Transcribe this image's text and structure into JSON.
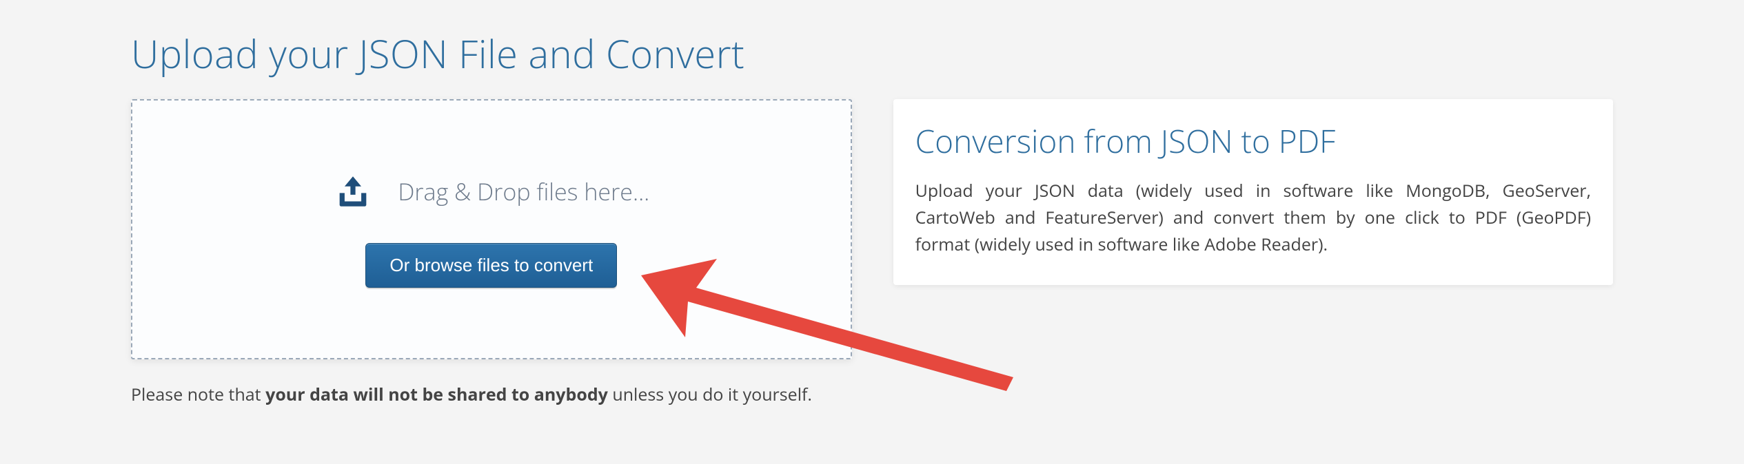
{
  "header": {
    "title": "Upload your JSON File and Convert"
  },
  "dropzone": {
    "drag_label": "Drag & Drop files here...",
    "browse_label": "Or browse files to convert"
  },
  "info": {
    "title": "Conversion from JSON to PDF",
    "body": "Upload your JSON data (widely used in software like MongoDB, GeoServer, CartoWeb and FeatureServer) and convert them by one click to PDF (GeoPDF) format (widely used in software like Adobe Reader)."
  },
  "note": {
    "prefix": "Please note that ",
    "bold": "your data will not be shared to anybody",
    "suffix": " unless you do it yourself."
  },
  "colors": {
    "accent": "#2f6e9e",
    "button_bg": "#2268a0",
    "arrow": "#e6483e"
  },
  "icons": {
    "upload": "upload-icon"
  }
}
